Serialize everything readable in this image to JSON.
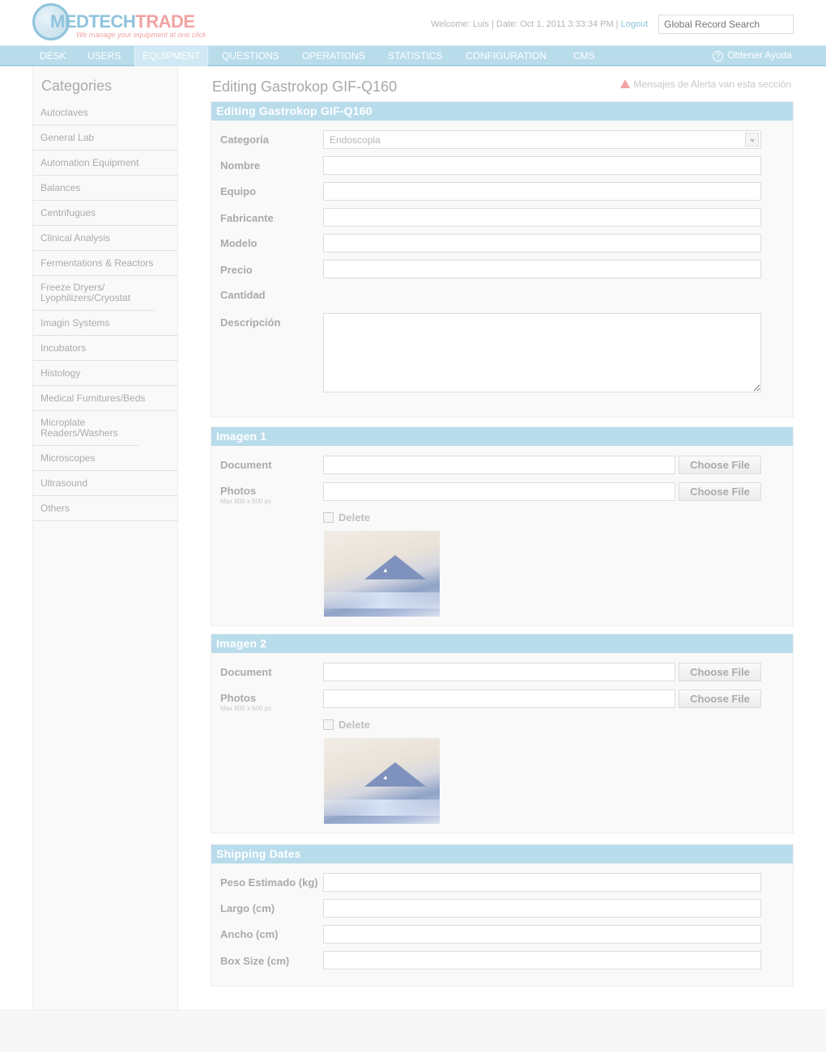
{
  "header": {
    "logo_part1": "MEDTECH",
    "logo_part2": "TRADE",
    "logo_tagline": "We manage your equipment at one click",
    "welcome_text": "Welcome: Luis | Date: Oct 1, 2011 3:33:34 PM |",
    "logout_label": "Logout",
    "search_placeholder": "Global Record Search"
  },
  "nav": {
    "items": [
      {
        "label": "DESK"
      },
      {
        "label": "USERS"
      },
      {
        "label": "EQUIPMENT",
        "active": true
      },
      {
        "label": "QUESTIONS"
      },
      {
        "label": "OPERATIONS"
      },
      {
        "label": "STATISTICS"
      },
      {
        "label": "CONFIGURATION"
      },
      {
        "label": "CMS"
      }
    ],
    "help_label": "Obtener Ayuda"
  },
  "sidebar": {
    "title": "Categories",
    "items": [
      "Autoclaves",
      "General Lab",
      "Automation Equipment",
      "Balances",
      "Centrifugues",
      "Clinical Analysis",
      "Fermentations & Reactors",
      "Freeze Dryers/ Lyophilizers/Cryostat",
      "Imagin Systems",
      "Incubators",
      "Histology",
      "Medical Furnitures/Beds",
      "Microplate Readers/Washers",
      "Microscopes",
      "Ultrasound",
      "Others"
    ]
  },
  "page": {
    "title": "Editing Gastrokop GIF-Q160",
    "alert": "Mensajes de Alerta van esta sección"
  },
  "form": {
    "head": "Editing Gastrokop GIF-Q160",
    "categoria_label": "Categoria",
    "categoria_value": "Endoscopia",
    "nombre_label": "Nombre",
    "equipo_label": "Equipo",
    "fabricante_label": "Fabricante",
    "modelo_label": "Modelo",
    "precio_label": "Precio",
    "cantidad_label": "Cantidad",
    "descripcion_label": "Descripción"
  },
  "imagen1": {
    "head": "Imagen 1",
    "document_label": "Document",
    "photos_label": "Photos",
    "photos_hint": "Max 800 x 600 px",
    "choose_file": "Choose File",
    "delete_label": "Delete"
  },
  "imagen2": {
    "head": "Imagen 2",
    "document_label": "Document",
    "photos_label": "Photos",
    "photos_hint": "Max 800 x 600 px",
    "choose_file": "Choose File",
    "delete_label": "Delete"
  },
  "shipping": {
    "head": "Shipping Dates",
    "peso_label": "Peso Estimado (kg)",
    "largo_label": "Largo (cm)",
    "ancho_label": "Ancho (cm)",
    "box_label": "Box Size (cm)"
  },
  "colors": {
    "accent": "#b9dceb",
    "logo_blue": "#8fc3dc",
    "logo_pink": "#f1a3a3"
  }
}
